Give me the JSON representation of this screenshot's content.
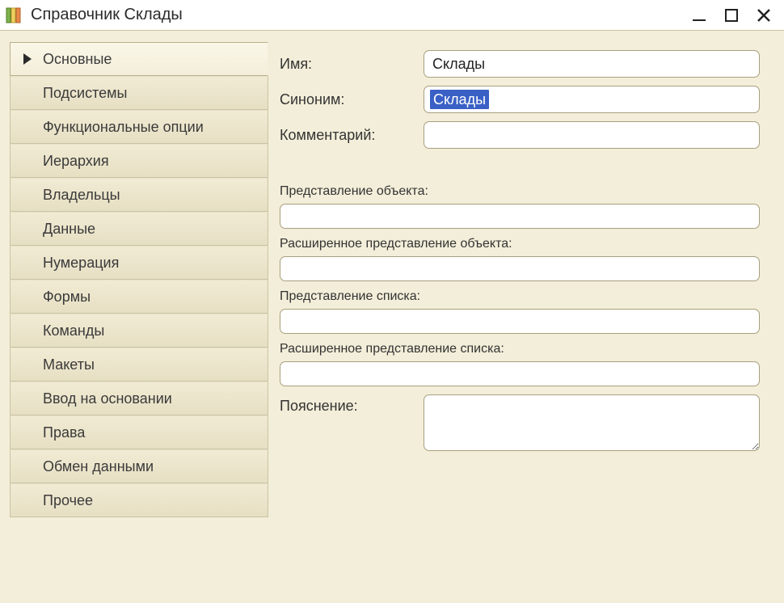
{
  "window": {
    "title": "Справочник Склады"
  },
  "sidebar": {
    "tabs": [
      {
        "label": "Основные",
        "active": true
      },
      {
        "label": "Подсистемы"
      },
      {
        "label": "Функциональные опции"
      },
      {
        "label": "Иерархия"
      },
      {
        "label": "Владельцы"
      },
      {
        "label": "Данные"
      },
      {
        "label": "Нумерация"
      },
      {
        "label": "Формы"
      },
      {
        "label": "Команды"
      },
      {
        "label": "Макеты"
      },
      {
        "label": "Ввод на основании"
      },
      {
        "label": "Права"
      },
      {
        "label": "Обмен данными"
      },
      {
        "label": "Прочее"
      }
    ]
  },
  "form": {
    "name_label": "Имя:",
    "name_value": "Склады",
    "synonym_label": "Синоним:",
    "synonym_value": "Склады",
    "comment_label": "Комментарий:",
    "comment_value": "",
    "object_presentation_label": "Представление объекта:",
    "object_presentation_value": "",
    "ext_object_presentation_label": "Расширенное представление объекта:",
    "ext_object_presentation_value": "",
    "list_presentation_label": "Представление списка:",
    "list_presentation_value": "",
    "ext_list_presentation_label": "Расширенное представление списка:",
    "ext_list_presentation_value": "",
    "explanation_label": "Пояснение:",
    "explanation_value": ""
  }
}
